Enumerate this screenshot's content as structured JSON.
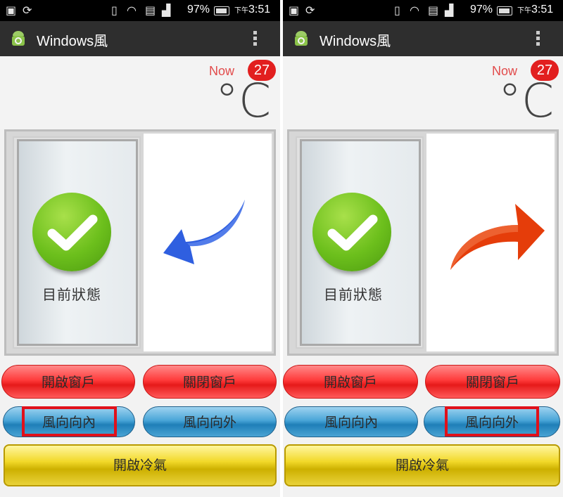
{
  "panels": [
    {
      "status": {
        "battery": "97%",
        "time_prefix": "下午",
        "time": "3:51"
      },
      "app": {
        "title": "Windows風"
      },
      "weather": {
        "now_label": "Now",
        "temperature": "27",
        "unit": "°C"
      },
      "window": {
        "state_label": "目前狀態",
        "airflow_arrow": "arrow-inward-icon",
        "arrow_color": "#2f5fe0"
      },
      "buttons": {
        "open_window": "開啟窗戶",
        "close_window": "關閉窗戶",
        "wind_in": "風向向內",
        "wind_out": "風向向外",
        "ac_on": "開啟冷氣"
      },
      "highlighted": "wind_in"
    },
    {
      "status": {
        "battery": "97%",
        "time_prefix": "下午",
        "time": "3:51"
      },
      "app": {
        "title": "Windows風"
      },
      "weather": {
        "now_label": "Now",
        "temperature": "27",
        "unit": "°C"
      },
      "window": {
        "state_label": "目前狀態",
        "airflow_arrow": "arrow-outward-icon",
        "arrow_color": "#e53d0a"
      },
      "buttons": {
        "open_window": "開啟窗戶",
        "close_window": "關閉窗戶",
        "wind_in": "風向向內",
        "wind_out": "風向向外",
        "ac_on": "開啟冷氣"
      },
      "highlighted": "wind_out"
    }
  ],
  "colors": {
    "highlight": "#e0101a",
    "temp_badge": "#e21f1f",
    "now_label": "#e24b4b"
  }
}
